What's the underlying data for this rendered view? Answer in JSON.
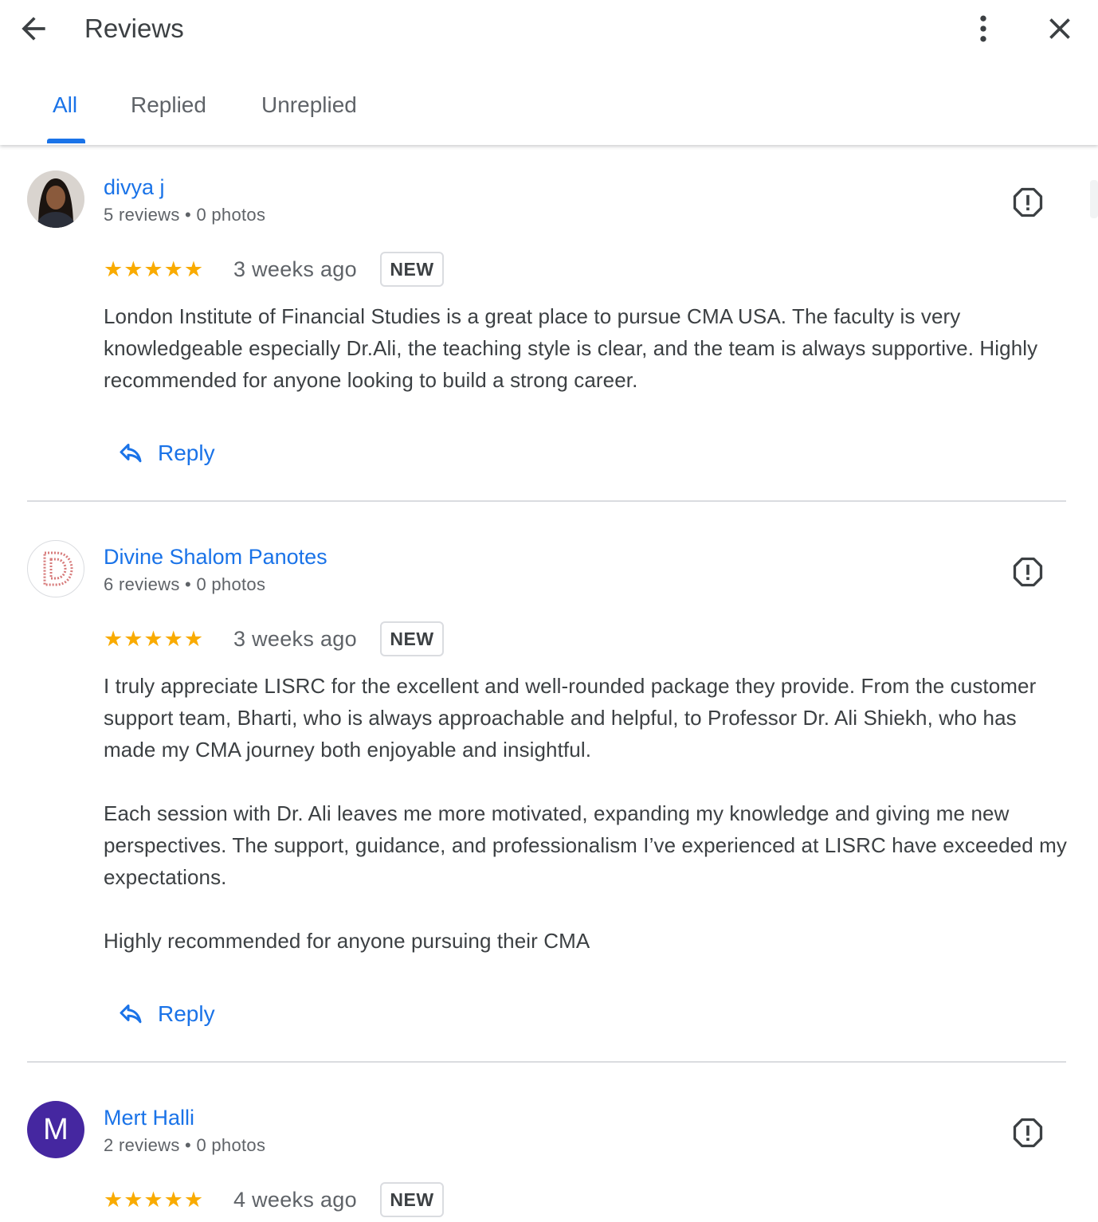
{
  "header": {
    "title": "Reviews",
    "back_icon": "arrow-back-icon",
    "more_icon": "more-vert-icon",
    "close_icon": "close-icon"
  },
  "tabs": [
    {
      "label": "All",
      "active": true
    },
    {
      "label": "Replied",
      "active": false
    },
    {
      "label": "Unreplied",
      "active": false
    }
  ],
  "reviews": [
    {
      "name": "divya j",
      "meta": "5 reviews • 0 photos",
      "rating": 5,
      "stars": "★★★★★",
      "date": "3 weeks ago",
      "badge": "NEW",
      "text": "London Institute of Financial Studies is a great place to pursue CMA USA. The faculty is very knowledgeable especially Dr.Ali, the teaching style is clear, and the team is always supportive. Highly recommended for anyone looking to build a strong career.",
      "reply_label": "Reply",
      "avatar": "photo"
    },
    {
      "name": "Divine Shalom Panotes",
      "meta": "6 reviews • 0 photos",
      "rating": 5,
      "stars": "★★★★★",
      "date": "3 weeks ago",
      "badge": "NEW",
      "text": "I truly appreciate LISRC for the excellent and well-rounded package they provide. From the customer support team, Bharti, who is always approachable and helpful, to Professor Dr. Ali Shiekh, who has made my CMA journey both enjoyable and insightful.\n\nEach session with Dr. Ali leaves me more motivated, expanding my knowledge and giving me new perspectives. The support, guidance, and professionalism I’ve experienced at LISRC have exceeded my expectations.\n\nHighly recommended for anyone pursuing their CMA",
      "reply_label": "Reply",
      "avatar": "logo",
      "avatar_letter": "D"
    },
    {
      "name": "Mert Halli",
      "meta": "2 reviews • 0 photos",
      "rating": 5,
      "stars": "★★★★★",
      "date": "4 weeks ago",
      "badge": "NEW",
      "avatar": "initial",
      "avatar_letter": "M",
      "avatar_color": "#4527a0"
    }
  ],
  "colors": {
    "accent": "#1a73e8",
    "star": "#f9ab00",
    "text": "#3c4043",
    "muted": "#5f6368"
  }
}
